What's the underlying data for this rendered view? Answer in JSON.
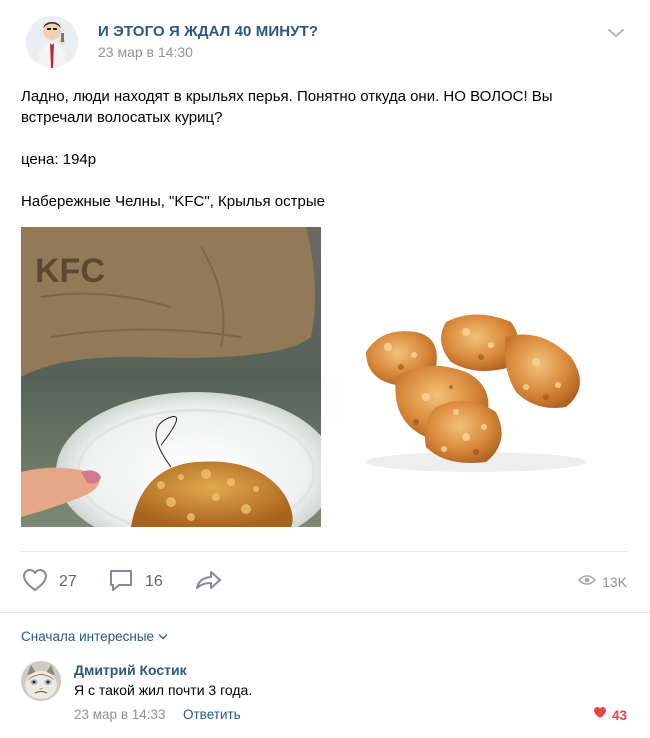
{
  "post": {
    "group_name": "И ЭТОГО Я ЖДАЛ 40 МИНУТ?",
    "date": "23 мар в 14:30",
    "text_line1": "Ладно, люди находят в крыльях перья. Понятно откуда они. НО ВОЛОС! Вы",
    "text_line2": "встречали волосатых куриц?",
    "price": "цена: 194р",
    "location": "Набережные Челны, \"KFC\", Крылья острые",
    "photo_bag_text": "KFC"
  },
  "actions": {
    "likes": "27",
    "comments": "16",
    "views": "13K"
  },
  "icons": {
    "header": "chevron-down-icon",
    "like": "heart-icon",
    "comment": "comment-icon",
    "share": "share-arrow-icon",
    "views": "eye-icon",
    "comment_like": "heart-filled-icon"
  },
  "comments": {
    "sort_label": "Сначала интересные",
    "items": [
      {
        "author": "Дмитрий Костик",
        "text": "Я с такой жил почти 3 года.",
        "date": "23 мар в 14:33",
        "reply_label": "Ответить",
        "likes": "43"
      }
    ]
  },
  "colors": {
    "link": "#2a5885",
    "muted": "#939393",
    "like_red": "#e64646",
    "divider": "#e7e8ec"
  }
}
